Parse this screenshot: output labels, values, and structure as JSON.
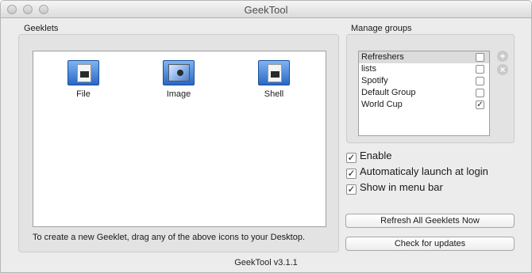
{
  "window": {
    "title": "GeekTool"
  },
  "geeklets": {
    "section_label": "Geeklets",
    "items": [
      {
        "label": "File",
        "icon": "file-geeklet-icon"
      },
      {
        "label": "Image",
        "icon": "image-geeklet-icon"
      },
      {
        "label": "Shell",
        "icon": "shell-geeklet-icon"
      }
    ],
    "help_text": "To create a new Geeklet, drag any of the above icons to your Desktop."
  },
  "groups": {
    "section_label": "Manage groups",
    "items": [
      {
        "name": "Refreshers",
        "checked": false,
        "selected": true
      },
      {
        "name": "lists",
        "checked": false,
        "selected": false
      },
      {
        "name": "Spotify",
        "checked": false,
        "selected": false
      },
      {
        "name": "Default Group",
        "checked": false,
        "selected": false
      },
      {
        "name": "World Cup",
        "checked": true,
        "selected": false
      }
    ],
    "add_icon": "plus-icon",
    "remove_icon": "close-icon",
    "check_mark": "✓"
  },
  "options": {
    "enable_label": "Enable",
    "auto_launch_label": "Automaticaly launch at login",
    "menu_bar_label": "Show in menu bar",
    "enable": true,
    "auto_launch": true,
    "menu_bar": true,
    "check_mark": "✓"
  },
  "buttons": {
    "refresh_label": "Refresh All Geeklets Now",
    "check_updates_label": "Check for updates"
  },
  "footer": {
    "version": "GeekTool v3.1.1"
  }
}
